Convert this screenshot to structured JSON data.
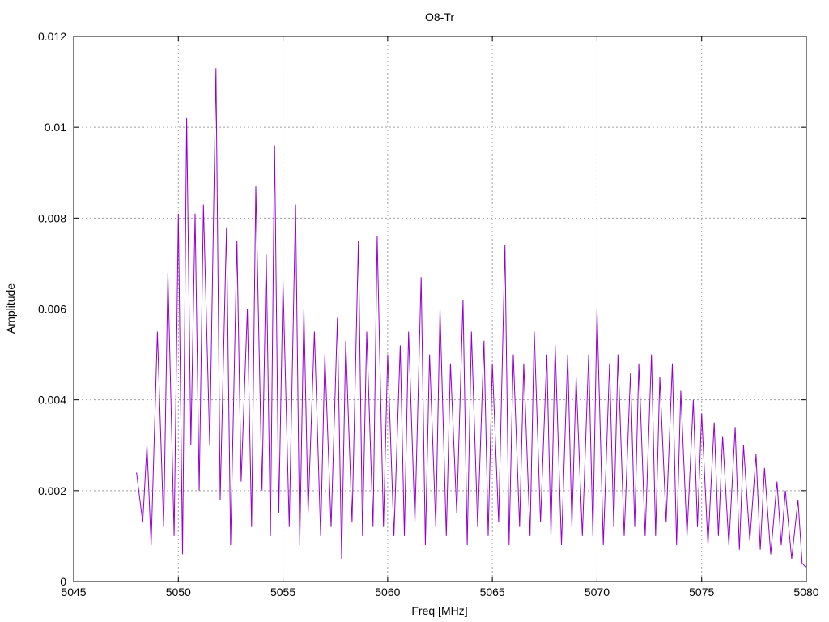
{
  "chart_data": {
    "type": "line",
    "title": "O8-Tr",
    "xlabel": "Freq [MHz]",
    "ylabel": "Amplitude",
    "xlim": [
      5045,
      5080
    ],
    "ylim": [
      0,
      0.012
    ],
    "x_ticks": [
      "5045",
      "5050",
      "5055",
      "5060",
      "5065",
      "5070",
      "5075",
      "5080"
    ],
    "y_ticks": [
      "0",
      "0.002",
      "0.004",
      "0.006",
      "0.008",
      "0.01",
      "0.012"
    ],
    "grid": true,
    "legend": "none",
    "series": [
      {
        "color": "#9400d3",
        "x": [
          5048.0,
          5048.3,
          5048.5,
          5048.7,
          5049.0,
          5049.3,
          5049.5,
          5049.8,
          5050.0,
          5050.2,
          5050.4,
          5050.6,
          5050.8,
          5051.0,
          5051.2,
          5051.5,
          5051.8,
          5052.0,
          5052.3,
          5052.5,
          5052.8,
          5053.0,
          5053.3,
          5053.5,
          5053.7,
          5054.0,
          5054.2,
          5054.4,
          5054.6,
          5054.8,
          5055.0,
          5055.3,
          5055.6,
          5055.8,
          5056.0,
          5056.2,
          5056.5,
          5056.8,
          5057.0,
          5057.3,
          5057.6,
          5057.8,
          5058.0,
          5058.3,
          5058.6,
          5058.8,
          5059.0,
          5059.3,
          5059.5,
          5059.8,
          5060.0,
          5060.3,
          5060.6,
          5060.8,
          5061.0,
          5061.3,
          5061.6,
          5061.8,
          5062.0,
          5062.3,
          5062.5,
          5062.8,
          5063.0,
          5063.3,
          5063.6,
          5063.8,
          5064.0,
          5064.3,
          5064.6,
          5064.8,
          5065.0,
          5065.3,
          5065.6,
          5065.8,
          5066.0,
          5066.3,
          5066.5,
          5066.8,
          5067.0,
          5067.3,
          5067.6,
          5067.8,
          5068.0,
          5068.3,
          5068.6,
          5068.8,
          5069.0,
          5069.3,
          5069.6,
          5069.8,
          5070.0,
          5070.3,
          5070.6,
          5070.8,
          5071.0,
          5071.3,
          5071.6,
          5071.8,
          5072.0,
          5072.3,
          5072.6,
          5072.8,
          5073.0,
          5073.3,
          5073.6,
          5073.8,
          5074.0,
          5074.3,
          5074.6,
          5074.8,
          5075.0,
          5075.3,
          5075.6,
          5075.8,
          5076.0,
          5076.3,
          5076.6,
          5076.8,
          5077.0,
          5077.3,
          5077.6,
          5077.8,
          5078.0,
          5078.3,
          5078.6,
          5078.8,
          5079.0,
          5079.3,
          5079.6,
          5079.8,
          5080.0
        ],
        "y": [
          0.0024,
          0.0013,
          0.003,
          0.0008,
          0.0055,
          0.0012,
          0.0068,
          0.001,
          0.0081,
          0.0006,
          0.0102,
          0.003,
          0.0081,
          0.002,
          0.0083,
          0.003,
          0.0113,
          0.0018,
          0.0078,
          0.0008,
          0.0075,
          0.0022,
          0.006,
          0.0012,
          0.0087,
          0.002,
          0.0072,
          0.001,
          0.0096,
          0.0015,
          0.0066,
          0.0012,
          0.0083,
          0.0008,
          0.006,
          0.0015,
          0.0055,
          0.001,
          0.005,
          0.0012,
          0.0058,
          0.0005,
          0.0053,
          0.0013,
          0.0075,
          0.001,
          0.0055,
          0.0012,
          0.0076,
          0.0012,
          0.005,
          0.001,
          0.0052,
          0.001,
          0.0055,
          0.0013,
          0.0067,
          0.0008,
          0.005,
          0.0012,
          0.006,
          0.001,
          0.0048,
          0.0015,
          0.0062,
          0.0008,
          0.0055,
          0.0012,
          0.0053,
          0.001,
          0.0048,
          0.0013,
          0.0074,
          0.0008,
          0.005,
          0.0012,
          0.0048,
          0.001,
          0.0055,
          0.0013,
          0.005,
          0.001,
          0.0052,
          0.0008,
          0.005,
          0.0012,
          0.0045,
          0.001,
          0.005,
          0.001,
          0.006,
          0.0008,
          0.0048,
          0.0012,
          0.005,
          0.001,
          0.0046,
          0.0012,
          0.0048,
          0.001,
          0.005,
          0.001,
          0.0045,
          0.0013,
          0.0048,
          0.0008,
          0.0042,
          0.001,
          0.004,
          0.0012,
          0.0037,
          0.0008,
          0.0035,
          0.001,
          0.0032,
          0.0008,
          0.0034,
          0.0007,
          0.003,
          0.0009,
          0.0028,
          0.0007,
          0.0025,
          0.0006,
          0.0022,
          0.0008,
          0.002,
          0.0005,
          0.0018,
          0.0004,
          0.0003
        ]
      }
    ]
  }
}
